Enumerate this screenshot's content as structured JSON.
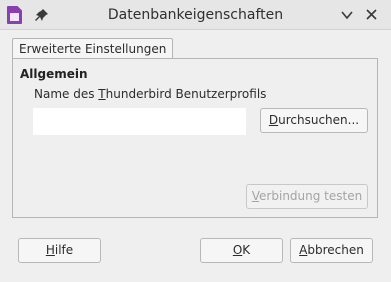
{
  "window": {
    "title": "Datenbankeigenschaften",
    "icons": {
      "app": "writer-document-icon",
      "pin": "pin-icon",
      "minimize": "chevron-down-icon",
      "close": "close-icon"
    }
  },
  "tabs": [
    {
      "label": "Erweiterte Einstellungen",
      "selected": true
    }
  ],
  "panel": {
    "heading": "Allgemein",
    "profile_label": {
      "before": "Name des ",
      "mnemonic": "T",
      "after": "hunderbird Benutzerprofils"
    },
    "profile_value": "",
    "browse_button": {
      "before": "",
      "mnemonic": "D",
      "after": "urchsuchen..."
    },
    "test_button": {
      "before": "",
      "mnemonic": "V",
      "after": "erbindung testen",
      "disabled": true
    }
  },
  "footer": {
    "help_button": {
      "before": "",
      "mnemonic": "H",
      "after": "ilfe"
    },
    "ok_button": {
      "before": "",
      "mnemonic": "O",
      "after": "K"
    },
    "cancel_button": {
      "before": "",
      "mnemonic": "A",
      "after": "bbrechen"
    }
  },
  "colors": {
    "window_bg": "#efefef",
    "app_icon": "#8a3fb0",
    "disabled_text": "#a4a4a4"
  }
}
